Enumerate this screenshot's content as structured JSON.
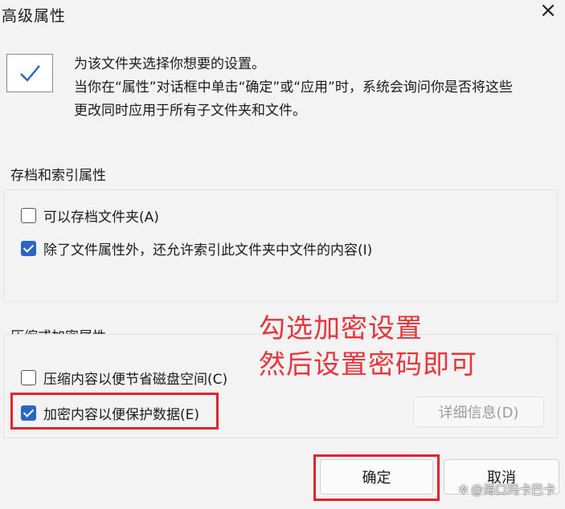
{
  "dialog": {
    "title": "高级属性",
    "close_glyph": "×"
  },
  "intro": {
    "line1": "为该文件夹选择你想要的设置。",
    "line2": "当你在“属性”对话框中单击“确定”或“应用”时，系统会询问你是否将这些",
    "line3": "更改同时应用于所有子文件夹和文件。"
  },
  "archive_group": {
    "title": "存档和索引属性",
    "options": [
      {
        "label": "可以存档文件夹(A)",
        "checked": false
      },
      {
        "label": "除了文件属性外，还允许索引此文件夹中文件的内容(I)",
        "checked": true
      }
    ]
  },
  "compress_group": {
    "title": "压缩或加密属性",
    "options": [
      {
        "label": "压缩内容以便节省磁盘空间(C)",
        "checked": false
      },
      {
        "label": "加密内容以便保护数据(E)",
        "checked": true
      }
    ],
    "details_button": "详细信息(D)"
  },
  "annotation": {
    "line1": "勾选加密设置",
    "line2": "然后设置密码即可",
    "color": "#e8343a"
  },
  "buttons": {
    "ok": "确定",
    "cancel": "取消"
  },
  "watermark": {
    "text": "@海口玛卡巴卡",
    "icon": "aperture-icon"
  },
  "colors": {
    "highlight_border": "#e0232c",
    "checkbox_accent": "#2a64c8"
  }
}
